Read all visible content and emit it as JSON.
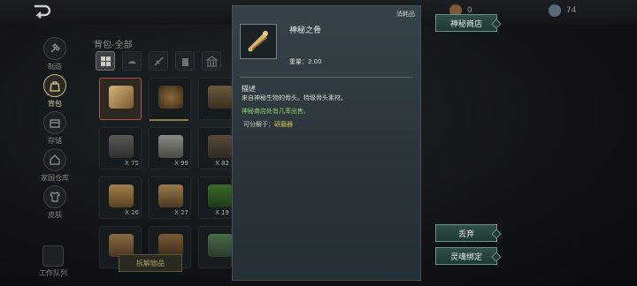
{
  "topbar": {
    "resource_1": "0",
    "resource_2": "74"
  },
  "nav": {
    "items": [
      {
        "label": "制造"
      },
      {
        "label": "背包"
      },
      {
        "label": "存储"
      },
      {
        "label": "家园仓库"
      },
      {
        "label": "皮肤"
      }
    ],
    "work_queue": "工作队列"
  },
  "bag": {
    "title": "背包-全部",
    "slots": [
      {
        "count": ""
      },
      {
        "count": ""
      },
      {
        "count": ""
      },
      {
        "count": "X 75"
      },
      {
        "count": "X 99"
      },
      {
        "count": "X 82"
      },
      {
        "count": "X 26"
      },
      {
        "count": "X 27"
      },
      {
        "count": "X 19"
      },
      {
        "count": ""
      },
      {
        "count": ""
      },
      {
        "count": ""
      }
    ],
    "dismantle_button": "拆解物品"
  },
  "detail": {
    "tag": "消耗品",
    "item_name": "神秘之骨",
    "weight": "重量：2.00",
    "section_title": "描述",
    "description": "来自神秘生物的骨头。特级骨头素材。",
    "shop_note": "神秘商店处有几率出售。",
    "decompose_prefix": "可分解于：",
    "decompose_target": "研磨器"
  },
  "actions": {
    "mystery_shop": "神秘商店",
    "discard": "丢弃",
    "soul_bind": "灵魂绑定"
  },
  "colors": {
    "accent_green": "#8fd06a",
    "accent_yellow": "#d6c74b",
    "button_teal": "#2f5049"
  }
}
